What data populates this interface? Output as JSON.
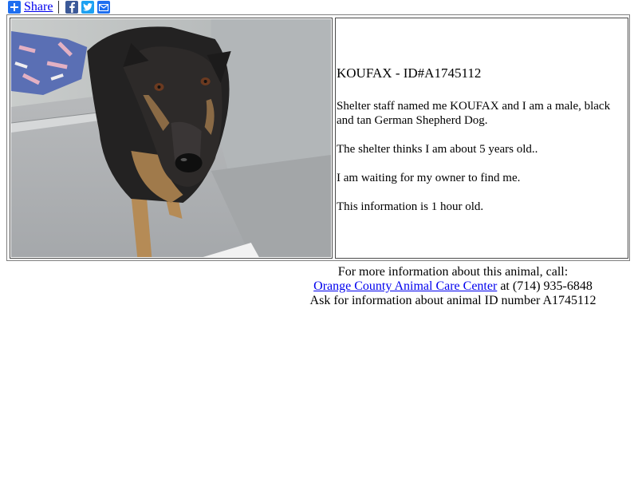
{
  "share": {
    "label": "Share",
    "icons": [
      "plus-icon",
      "facebook-icon",
      "twitter-icon",
      "email-icon"
    ],
    "colors": {
      "plus": "#1f6ff0",
      "facebook": "#3b5998",
      "twitter": "#1da1f2",
      "email": "#1f6ff0"
    }
  },
  "animal": {
    "title": "KOUFAX - ID#A1745112",
    "description": "Shelter staff named me KOUFAX and I am a male, black and tan German Shepherd Dog.",
    "age": "The shelter thinks I am about 5 years old..",
    "status": "I am waiting for my owner to find me.",
    "freshness": "This information is 1 hour old."
  },
  "contact": {
    "line1": "For more information about this animal, call:",
    "center_link": "Orange County Animal Care Center",
    "phone_text": " at (714) 935-6848",
    "line3": "Ask for information about animal ID number A1745112"
  }
}
